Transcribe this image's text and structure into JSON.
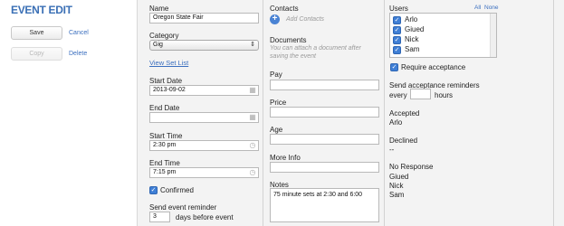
{
  "header": {
    "title": "EVENT EDIT"
  },
  "actions": {
    "save_label": "Save",
    "cancel_label": "Cancel",
    "copy_label": "Copy",
    "delete_label": "Delete"
  },
  "form": {
    "name": {
      "label": "Name",
      "value": "Oregon State Fair"
    },
    "category": {
      "label": "Category",
      "value": "Gig"
    },
    "view_set_list_label": "View Set List",
    "start_date": {
      "label": "Start Date",
      "value": "2013-09-02"
    },
    "end_date": {
      "label": "End Date",
      "value": ""
    },
    "start_time": {
      "label": "Start Time",
      "value": "2:30 pm"
    },
    "end_time": {
      "label": "End Time",
      "value": "7:15 pm"
    },
    "confirmed": {
      "label": "Confirmed",
      "checked": true
    },
    "reminder": {
      "label": "Send event reminder",
      "days_value": "3",
      "suffix": "days before event"
    }
  },
  "middle": {
    "contacts": {
      "label": "Contacts",
      "add_label": "Add Contacts"
    },
    "documents": {
      "label": "Documents",
      "hint": "You can attach a document after saving the event"
    },
    "pay": {
      "label": "Pay",
      "value": ""
    },
    "price": {
      "label": "Price",
      "value": ""
    },
    "age": {
      "label": "Age",
      "value": ""
    },
    "more_info": {
      "label": "More Info",
      "value": ""
    },
    "notes": {
      "label": "Notes",
      "value": "75 minute sets at 2:30 and 6:00"
    }
  },
  "right": {
    "users": {
      "label": "Users",
      "all_label": "All",
      "none_label": "None",
      "items": [
        {
          "name": "Arlo",
          "checked": true
        },
        {
          "name": "Giued",
          "checked": true
        },
        {
          "name": "Nick",
          "checked": true
        },
        {
          "name": "Sam",
          "checked": true
        }
      ]
    },
    "require_acceptance": {
      "label": "Require acceptance",
      "checked": true
    },
    "acceptance_reminders": {
      "label": "Send acceptance reminders",
      "prefix": "every",
      "value": "",
      "suffix": "hours"
    },
    "accepted": {
      "label": "Accepted",
      "names": [
        "Arlo"
      ]
    },
    "declined": {
      "label": "Declined",
      "names": [
        "--"
      ]
    },
    "no_response": {
      "label": "No Response",
      "names": [
        "Giued",
        "Nick",
        "Sam"
      ]
    }
  },
  "colors": {
    "accent": "#3a6fb5",
    "checkbox": "#3f7fd6",
    "panel": "#f3f3f3"
  }
}
